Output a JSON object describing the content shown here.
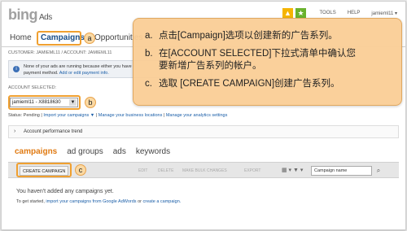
{
  "header": {
    "logo": "bing",
    "logo_sub": "Ads",
    "links": [
      "TOOLS",
      "HELP",
      "jamieml11 ▾"
    ]
  },
  "tabs": [
    "Home",
    "Campaigns",
    "Opportunities"
  ],
  "badges": {
    "a": "a",
    "b": "b",
    "c": "c"
  },
  "customer_line": "CUSTOMER: JAMIEML11 / ACCOUNT: JAMIEML11",
  "alert": {
    "line1": "None of your ads are running because either you have",
    "line2": "payment method.",
    "link": "Add or edit payment info."
  },
  "account": {
    "label": "ACCOUNT SELECTED:",
    "value": "jamieml11 - X8818630"
  },
  "status_line": {
    "prefix": "Status: Pending |",
    "links": [
      "Import your campaigns ▼",
      "Manage your business locations",
      "Manage your analytics settings"
    ]
  },
  "trend": {
    "label": "Account performance trend"
  },
  "subtabs": [
    "campaigns",
    "ad groups",
    "ads",
    "keywords"
  ],
  "toolbar": {
    "create": "CREATE CAMPAIGN",
    "faded": [
      "EDIT",
      "DELETE",
      "MAKE BULK CHANGES",
      "EXPORT"
    ],
    "search_placeholder": "Campaign name"
  },
  "empty": {
    "title": "You haven't added any campaigns yet.",
    "prefix": "To get started,",
    "link1": "import your campaigns from Google AdWords",
    "mid": "or",
    "link2": "create a campaign."
  },
  "instructions": [
    {
      "key": "a.",
      "lines": [
        "点击[Campaign]选项以创建新的广告系列。"
      ]
    },
    {
      "key": "b.",
      "lines": [
        "在[ACCOUNT SELECTED]下拉式清单中确认您",
        "要新增广告系列的帐户。"
      ]
    },
    {
      "key": "c.",
      "lines": [
        "选取 [CREATE CAMPAIGN]创建广告系列。"
      ]
    }
  ],
  "colors": {
    "accent": "#f0a030",
    "callout_bg": "#facd96",
    "active_subtab": "#e07a12",
    "link": "#1a5ea8"
  }
}
